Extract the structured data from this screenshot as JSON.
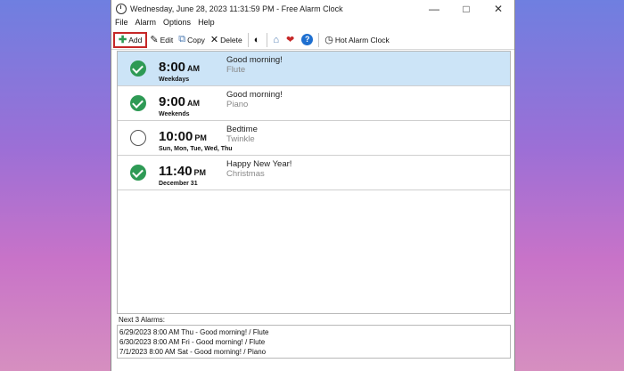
{
  "window": {
    "title": "Wednesday, June 28, 2023 11:31:59 PM - Free Alarm Clock"
  },
  "menu": [
    "File",
    "Alarm",
    "Options",
    "Help"
  ],
  "toolbar": {
    "add": "Add",
    "edit": "Edit",
    "copy": "Copy",
    "delete": "Delete",
    "hot": "Hot Alarm Clock"
  },
  "alarms": [
    {
      "time": "8:00",
      "ampm": "AM",
      "days": "Weekdays",
      "message": "Good morning!",
      "sound": "Flute",
      "enabled": true
    },
    {
      "time": "9:00",
      "ampm": "AM",
      "days": "Weekends",
      "message": "Good morning!",
      "sound": "Piano",
      "enabled": true
    },
    {
      "time": "10:00",
      "ampm": "PM",
      "days": "Sun, Mon, Tue, Wed, Thu",
      "message": "Bedtime",
      "sound": "Twinkle",
      "enabled": false
    },
    {
      "time": "11:40",
      "ampm": "PM",
      "days": "December 31",
      "message": "Happy New Year!",
      "sound": "Christmas",
      "enabled": true
    }
  ],
  "next": {
    "label": "Next 3 Alarms:",
    "items": [
      "6/29/2023 8:00 AM Thu - Good morning! / Flute",
      "6/30/2023 8:00 AM Fri - Good morning! / Flute",
      "7/1/2023 8:00 AM Sat - Good morning! / Piano"
    ]
  },
  "colors": {
    "accent": "#2e9a55",
    "selection": "#cce4f7",
    "highlight": "#c62828"
  }
}
